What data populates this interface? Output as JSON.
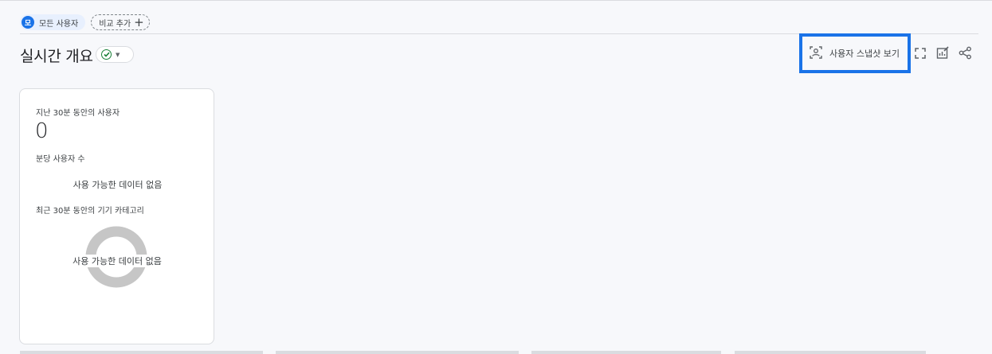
{
  "segment_chip": {
    "avatar": "모",
    "label": "모든 사용자"
  },
  "compare_chip": {
    "label": "비교 추가",
    "plus": "+"
  },
  "header": {
    "title": "실시간 개요"
  },
  "toolbar": {
    "snapshot_label": "사용자 스냅샷 보기",
    "icons": [
      "user-snapshot-icon",
      "fullscreen-icon",
      "customize-report-icon",
      "share-icon"
    ]
  },
  "card": {
    "users_30min_label": "지난 30분 동안의 사용자",
    "users_30min_value": "0",
    "per_minute_label": "분당 사용자 수",
    "per_minute_empty": "사용 가능한 데이터 없음",
    "device_label": "최근 30분 동안의 기기 카테고리",
    "device_empty": "사용 가능한 데이터 없음"
  },
  "colors": {
    "accent": "#1a73e8",
    "success": "#188038",
    "donut_empty": "#c6c6c6"
  }
}
